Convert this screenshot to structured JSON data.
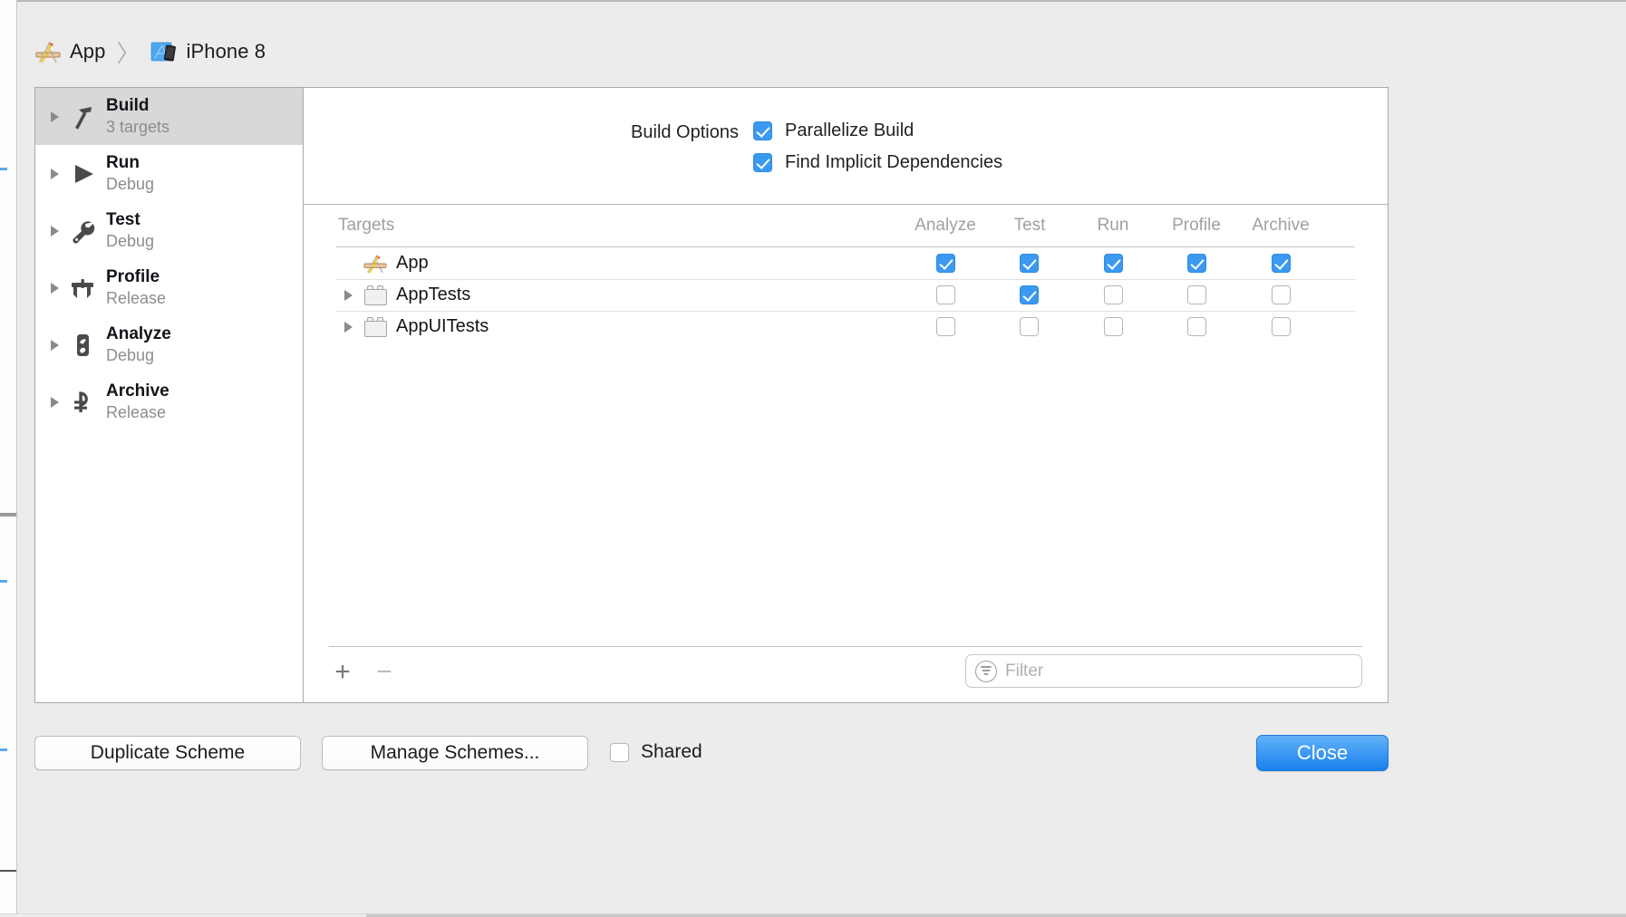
{
  "breadcrumb": {
    "scheme": {
      "icon": "xcode-app-icon",
      "label": "App"
    },
    "separator": "〉",
    "destination": {
      "icon": "iphone-simulator-icon",
      "label": "iPhone 8"
    }
  },
  "sidebar": {
    "items": [
      {
        "title": "Build",
        "subtitle": "3 targets",
        "icon": "hammer-icon",
        "selected": true
      },
      {
        "title": "Run",
        "subtitle": "Debug",
        "icon": "play-icon",
        "selected": false
      },
      {
        "title": "Test",
        "subtitle": "Debug",
        "icon": "wrench-icon",
        "selected": false
      },
      {
        "title": "Profile",
        "subtitle": "Release",
        "icon": "calipers-icon",
        "selected": false
      },
      {
        "title": "Analyze",
        "subtitle": "Debug",
        "icon": "analyze-icon",
        "selected": false
      },
      {
        "title": "Archive",
        "subtitle": "Release",
        "icon": "archive-icon",
        "selected": false
      }
    ]
  },
  "build_options": {
    "label": "Build Options",
    "rows": [
      {
        "label": "Parallelize Build",
        "checked": true
      },
      {
        "label": "Find Implicit Dependencies",
        "checked": true
      }
    ]
  },
  "targets_table": {
    "columns": [
      {
        "key": "targets",
        "label": "Targets"
      },
      {
        "key": "analyze",
        "label": "Analyze"
      },
      {
        "key": "test",
        "label": "Test"
      },
      {
        "key": "run",
        "label": "Run"
      },
      {
        "key": "profile",
        "label": "Profile"
      },
      {
        "key": "archive",
        "label": "Archive"
      }
    ],
    "rows": [
      {
        "name": "App",
        "icon": "xcode-app-icon",
        "disclosure": false,
        "analyze": true,
        "test": true,
        "run": true,
        "profile": true,
        "archive": true
      },
      {
        "name": "AppTests",
        "icon": "bundle-icon",
        "disclosure": true,
        "analyze": false,
        "test": true,
        "run": false,
        "profile": false,
        "archive": false
      },
      {
        "name": "AppUITests",
        "icon": "bundle-icon",
        "disclosure": true,
        "analyze": false,
        "test": false,
        "run": false,
        "profile": false,
        "archive": false
      }
    ],
    "toolbar": {
      "add_label": "+",
      "remove_label": "−",
      "filter_placeholder": "Filter",
      "filter_value": "",
      "filter_icon": "filter-icon"
    }
  },
  "footer": {
    "duplicate_label": "Duplicate Scheme",
    "manage_label": "Manage Schemes...",
    "shared_label": "Shared",
    "shared_checked": false,
    "close_label": "Close"
  },
  "colors": {
    "accent": "#3b99f0",
    "close_button": "#1880ee",
    "window_bg": "#ececec",
    "panel_bg": "#ffffff",
    "selected_row": "#d8d8d8",
    "muted_text": "#8d8d8d"
  }
}
